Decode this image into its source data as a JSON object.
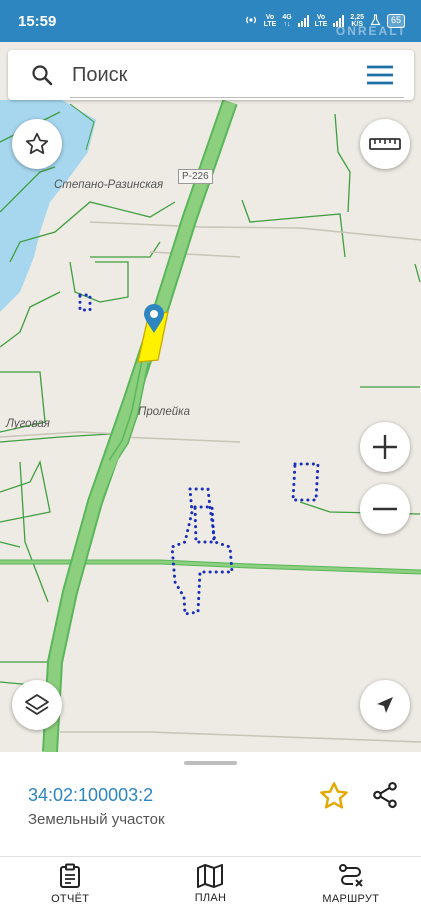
{
  "status_bar": {
    "time": "15:59",
    "net1_top": "Vo",
    "net1_bottom": "LTE",
    "net2_top": "4G",
    "net3_top": "Vo",
    "net3_bottom": "LTE",
    "speed_value": "2,25",
    "speed_unit": "K/S",
    "battery": "65",
    "watermark": "ONREALT"
  },
  "search": {
    "placeholder": "Поиск"
  },
  "map": {
    "labels": {
      "village1": "Степано-Разинская",
      "road_sign": "Р-226",
      "village2": "Пролейка",
      "village3": "Луговая"
    },
    "colors": {
      "background": "#eeebe4",
      "water": "#a7d7ef",
      "highway": "#8ccf7e",
      "boundary": "#3f9e3f",
      "parcel": "#1a2fb8",
      "selected_fill": "#fff200"
    }
  },
  "feature": {
    "cadastral_number": "34:02:100003:2",
    "type": "Земельный участок"
  },
  "nav": {
    "report": "ОТЧЁТ",
    "plan": "ПЛАН",
    "route": "МАРШРУТ"
  }
}
